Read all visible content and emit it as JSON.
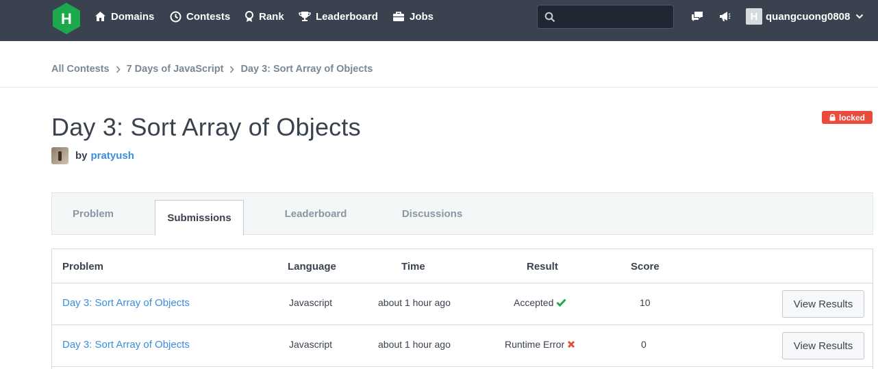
{
  "nav": {
    "items": [
      {
        "label": "Domains",
        "icon": "home-icon"
      },
      {
        "label": "Contests",
        "icon": "clock-icon"
      },
      {
        "label": "Rank",
        "icon": "rank-icon"
      },
      {
        "label": "Leaderboard",
        "icon": "trophy-icon"
      },
      {
        "label": "Jobs",
        "icon": "briefcase-icon"
      }
    ],
    "search_placeholder": "",
    "username": "quangcuong0808",
    "logo_letter": "H"
  },
  "breadcrumb": [
    "All Contests",
    "7 Days of JavaScript",
    "Day 3: Sort Array of Objects"
  ],
  "title": "Day 3: Sort Array of Objects",
  "author": {
    "by": "by",
    "name": "pratyush"
  },
  "badge": "locked",
  "tabs": [
    "Problem",
    "Submissions",
    "Leaderboard",
    "Discussions"
  ],
  "table": {
    "headers": [
      "Problem",
      "Language",
      "Time",
      "Result",
      "Score"
    ],
    "rows": [
      {
        "problem": "Day 3: Sort Array of Objects",
        "language": "Javascript",
        "time": "about 1 hour ago",
        "result": "Accepted",
        "status": "check-icon",
        "score": "10",
        "action": "View Results"
      },
      {
        "problem": "Day 3: Sort Array of Objects",
        "language": "Javascript",
        "time": "about 1 hour ago",
        "result": "Runtime Error",
        "status": "cross-icon",
        "score": "0",
        "action": "View Results"
      }
    ]
  },
  "colors": {
    "nav_bg": "#39424e",
    "logo": "#1ba94c",
    "link": "#3a8dde",
    "badge": "#e94b3c",
    "success": "#1ba94c",
    "error": "#e94b3c"
  }
}
